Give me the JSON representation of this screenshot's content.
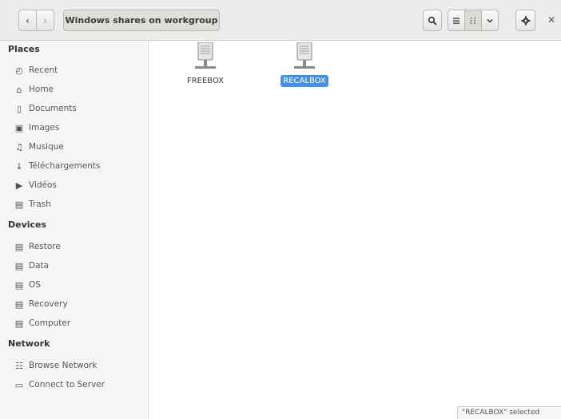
{
  "header": {
    "path_label": "Windows shares on workgroup"
  },
  "sidebar": {
    "places_title": "Places",
    "places": [
      {
        "label": "Recent",
        "icon": "clock-icon"
      },
      {
        "label": "Home",
        "icon": "home-icon"
      },
      {
        "label": "Documents",
        "icon": "document-icon"
      },
      {
        "label": "Images",
        "icon": "camera-icon"
      },
      {
        "label": "Musique",
        "icon": "music-icon"
      },
      {
        "label": "Téléchargements",
        "icon": "download-icon"
      },
      {
        "label": "Vidéos",
        "icon": "video-icon"
      },
      {
        "label": "Trash",
        "icon": "trash-icon"
      }
    ],
    "devices_title": "Devices",
    "devices": [
      {
        "label": "Restore",
        "icon": "drive-icon"
      },
      {
        "label": "Data",
        "icon": "drive-icon"
      },
      {
        "label": "OS",
        "icon": "drive-icon"
      },
      {
        "label": "Recovery",
        "icon": "drive-icon"
      },
      {
        "label": "Computer",
        "icon": "drive-icon"
      }
    ],
    "network_title": "Network",
    "network": [
      {
        "label": "Browse Network",
        "icon": "network-icon"
      },
      {
        "label": "Connect to Server",
        "icon": "server-icon"
      }
    ]
  },
  "shares": [
    {
      "label": "FREEBOX",
      "selected": false
    },
    {
      "label": "RECALBOX",
      "selected": true
    }
  ],
  "status": "\"RECALBOX\" selected",
  "colors": {
    "selection": "#4a90d9"
  }
}
